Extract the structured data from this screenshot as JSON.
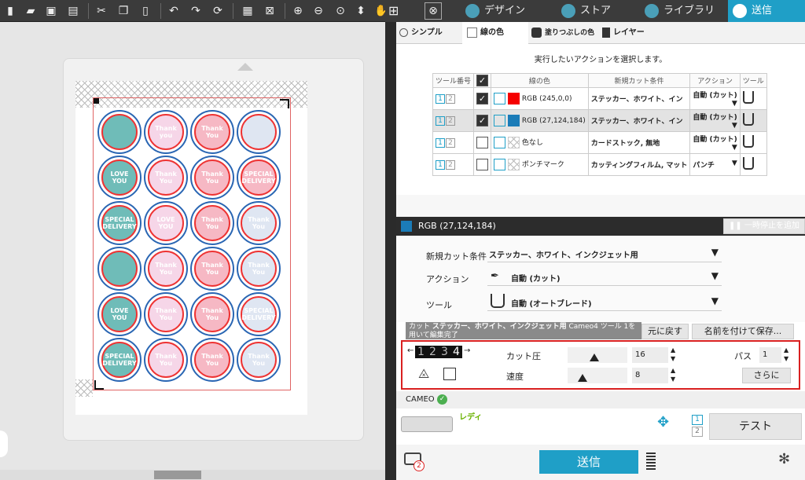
{
  "nav": {
    "design": "デザイン",
    "store": "ストア",
    "library": "ライブラリ",
    "send": "送信"
  },
  "panel_tabs": {
    "simple": "シンプル",
    "line_color": "線の色",
    "fill_color": "塗りつぶしの色",
    "layer": "レイヤー"
  },
  "instruction": "実行したいアクションを選択します。",
  "table": {
    "headers": [
      "ツール番号",
      "",
      "線の色",
      "新規カット条件",
      "アクション",
      "ツール"
    ],
    "rows": [
      {
        "tool1": "1",
        "tool2": "2",
        "checked": true,
        "swatch": "#f50000",
        "color_label": "RGB (245,0,0)",
        "condition": "ステッカー、ホワイト、イン",
        "action": "自動 (カット)",
        "highlight": false
      },
      {
        "tool1": "1",
        "tool2": "2",
        "checked": true,
        "swatch": "#1b7cb8",
        "color_label": "RGB (27,124,184)",
        "condition": "ステッカー、ホワイト、イン",
        "action": "自動 (カット)",
        "highlight": true
      },
      {
        "tool1": "1",
        "tool2": "2",
        "checked": false,
        "swatch": "none",
        "color_label": "色なし",
        "condition": "カードストック, 無地",
        "action": "自動 (カット)",
        "highlight": false
      },
      {
        "tool1": "1",
        "tool2": "2",
        "checked": false,
        "swatch": "none",
        "color_label": "ポンチマーク",
        "condition": "カッティングフィルム, マット",
        "action": "パンチ",
        "highlight": false
      }
    ]
  },
  "selected": {
    "swatch": "#1b7cb8",
    "label": "RGB (27,124,184)",
    "pause_button": "一時停止を追加"
  },
  "settings": {
    "material_label": "新規カット条件",
    "material_value": "ステッカー、ホワイト、インクジェット用",
    "action_label": "アクション",
    "action_value": "自動 (カット)",
    "tool_label": "ツール",
    "tool_value": "自動 (オートブレード)"
  },
  "cut_info": {
    "prefix": "カット",
    "material": "ステッカー、ホワイト、インクジェット用",
    "device": "Cameo4 ツール 1を用いて編集完了",
    "reset_button": "元に戻す",
    "save_as_button": "名前を付けて保存..."
  },
  "params": {
    "blade_digits": [
      "1",
      "2",
      "3",
      "4"
    ],
    "force_label": "カット圧",
    "force_value": "16",
    "force_level": 0.45,
    "passes_label": "パス",
    "passes_value": "1",
    "speed_label": "速度",
    "speed_value": "8",
    "speed_level": 0.25,
    "more_button": "さらに"
  },
  "device": {
    "name": "CAMEO",
    "status": "レディ",
    "tool_slots": [
      "1",
      "2"
    ],
    "test_button": "テスト"
  },
  "send_button": "送信",
  "badge_count": "2",
  "design_circles": [
    {
      "bg": "#6fbcb8",
      "text": ""
    },
    {
      "bg": "#f6d6e8",
      "text": "Thank you"
    },
    {
      "bg": "#f6b8c4",
      "text": "Thank You"
    },
    {
      "bg": "#dfe6f2",
      "text": ""
    },
    {
      "bg": "#6fbcb8",
      "text": "LOVE YOU"
    },
    {
      "bg": "#f6d6e8",
      "text": "Thank You"
    },
    {
      "bg": "#f6b8c4",
      "text": "Thank You"
    },
    {
      "bg": "#f6b8c4",
      "text": "SPECIAL DELIVERY"
    },
    {
      "bg": "#6fbcb8",
      "text": "SPECIAL DELIVERY"
    },
    {
      "bg": "#f6d6e8",
      "text": "LOVE YOU"
    },
    {
      "bg": "#f6b8c4",
      "text": "Thank You"
    },
    {
      "bg": "#dfe6f2",
      "text": "Thank You"
    },
    {
      "bg": "#6fbcb8",
      "text": ""
    },
    {
      "bg": "#f6d6e8",
      "text": "Thank You"
    },
    {
      "bg": "#f6b8c4",
      "text": "Thank You"
    },
    {
      "bg": "#dfe6f2",
      "text": "Thank You"
    },
    {
      "bg": "#6fbcb8",
      "text": "LOVE YOU"
    },
    {
      "bg": "#f6d6e8",
      "text": "Thank You"
    },
    {
      "bg": "#f6b8c4",
      "text": "Thank You"
    },
    {
      "bg": "#dfe6f2",
      "text": "SPECIAL DELIVERY"
    },
    {
      "bg": "#6fbcb8",
      "text": "SPECIAL DELIVERY"
    },
    {
      "bg": "#f6d6e8",
      "text": "Thank You"
    },
    {
      "bg": "#f6b8c4",
      "text": "Thank You"
    },
    {
      "bg": "#dfe6f2",
      "text": "Thank You"
    }
  ]
}
